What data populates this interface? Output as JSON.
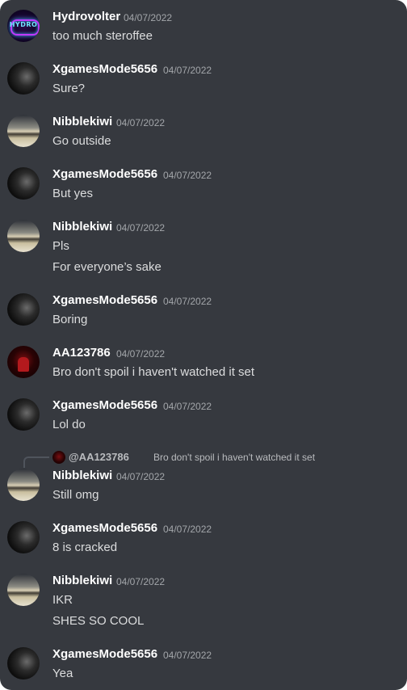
{
  "messages": [
    {
      "author": "Hydrovolter",
      "avatar": "hydrovolter-avatar",
      "timestamp": "04/07/2022",
      "lines": [
        "too much steroffee"
      ]
    },
    {
      "author": "XgamesMode5656",
      "avatar": "xgames-avatar",
      "timestamp": "04/07/2022",
      "lines": [
        "Sure?"
      ]
    },
    {
      "author": "Nibblekiwi",
      "avatar": "nibblekiwi-avatar",
      "timestamp": "04/07/2022",
      "lines": [
        "Go outside"
      ]
    },
    {
      "author": "XgamesMode5656",
      "avatar": "xgames-avatar",
      "timestamp": "04/07/2022",
      "lines": [
        "But yes"
      ]
    },
    {
      "author": "Nibblekiwi",
      "avatar": "nibblekiwi-avatar",
      "timestamp": "04/07/2022",
      "lines": [
        "Pls",
        "For everyone’s sake"
      ]
    },
    {
      "author": "XgamesMode5656",
      "avatar": "xgames-avatar",
      "timestamp": "04/07/2022",
      "lines": [
        "Boring"
      ]
    },
    {
      "author": "AA123786",
      "avatar": "aa123786-avatar",
      "timestamp": "04/07/2022",
      "lines": [
        "Bro don't spoil i haven't watched it set"
      ]
    },
    {
      "author": "XgamesMode5656",
      "avatar": "xgames-avatar",
      "timestamp": "04/07/2022",
      "lines": [
        "Lol do"
      ]
    },
    {
      "author": "Nibblekiwi",
      "avatar": "nibblekiwi-avatar",
      "timestamp": "04/07/2022",
      "lines": [
        "Still omg"
      ],
      "reply": {
        "mention": "@AA123786",
        "text": "Bro don't spoil i haven't watched it set"
      }
    },
    {
      "author": "XgamesMode5656",
      "avatar": "xgames-avatar",
      "timestamp": "04/07/2022",
      "lines": [
        "8 is cracked"
      ]
    },
    {
      "author": "Nibblekiwi",
      "avatar": "nibblekiwi-avatar",
      "timestamp": "04/07/2022",
      "lines": [
        "IKR",
        "SHES SO COOL"
      ]
    },
    {
      "author": "XgamesMode5656",
      "avatar": "xgames-avatar",
      "timestamp": "04/07/2022",
      "lines": [
        "Yea"
      ]
    }
  ],
  "avatar_badges": {
    "hydrovolter": "HYDRO"
  },
  "colors": {
    "background": "#36393f",
    "username": "#ffffff",
    "message_text": "#dcddde",
    "timestamp": "#a3a6aa"
  }
}
